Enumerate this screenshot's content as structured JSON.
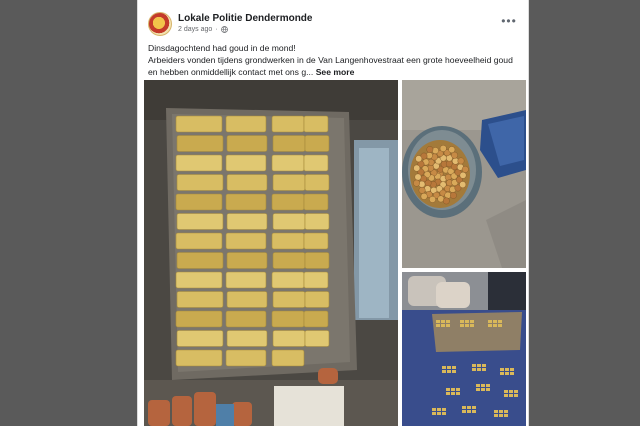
{
  "post": {
    "page_name": "Lokale Politie Dendermonde",
    "timestamp": "2 days ago",
    "privacy_icon": "globe-icon",
    "more_icon": "more-horizontal-icon",
    "more_label": "•••",
    "text_line1": "Dinsdagochtend had goud in de mond!",
    "text_line2": "Arbeiders vonden tijdens grondwerken in de  Van Langenhovestraat een grote hoeveelheid goud",
    "text_line3": "en hebben onmiddellijk contact met ons g...",
    "see_more": "See more"
  },
  "colors": {
    "page_background": "#5a5a5a",
    "card_background": "#ffffff",
    "name_text": "#1c1e21",
    "meta_text": "#65676b",
    "gold": "#d9b85a"
  },
  "media": {
    "photos": [
      {
        "id": "gold-bars-photo"
      },
      {
        "id": "coin-bowl-photo"
      },
      {
        "id": "gold-table-photo"
      }
    ]
  }
}
